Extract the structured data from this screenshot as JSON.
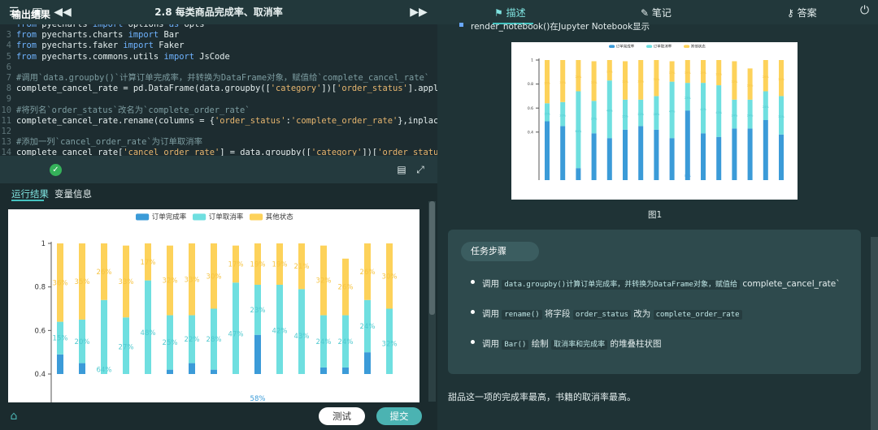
{
  "header": {
    "title": "2.8 每类商品完成率、取消率"
  },
  "code_lines": [
    {
      "n": "",
      "parts": [
        [
          "kw",
          "from"
        ],
        [
          "tx",
          " pyecharts "
        ],
        [
          "kw",
          "import"
        ],
        [
          "tx",
          " options "
        ],
        [
          "kw",
          "as"
        ],
        [
          "tx",
          " opts"
        ]
      ]
    },
    {
      "n": "3",
      "parts": [
        [
          "kw",
          "from"
        ],
        [
          "tx",
          " pyecharts.charts "
        ],
        [
          "kw",
          "import"
        ],
        [
          "tx",
          " Bar"
        ]
      ]
    },
    {
      "n": "4",
      "parts": [
        [
          "kw",
          "from"
        ],
        [
          "tx",
          " pyecharts.faker "
        ],
        [
          "kw",
          "import"
        ],
        [
          "tx",
          " Faker"
        ]
      ]
    },
    {
      "n": "5",
      "parts": [
        [
          "kw",
          "from"
        ],
        [
          "tx",
          " pyecharts.commons.utils "
        ],
        [
          "kw",
          "import"
        ],
        [
          "tx",
          " JsCode"
        ]
      ]
    },
    {
      "n": "6",
      "parts": []
    },
    {
      "n": "7",
      "parts": [
        [
          "cm",
          "#调用`data.groupby()`计算订单完成率，并转换为DataFrame对象，赋值给`complete_cancel_rate`"
        ]
      ]
    },
    {
      "n": "8",
      "parts": [
        [
          "tx",
          "complete_cancel_rate = pd.DataFrame(data.groupby(["
        ],
        [
          "st",
          "'category'"
        ],
        [
          "tx",
          "])["
        ],
        [
          "st",
          "'order_status'"
        ],
        [
          "tx",
          "].apply("
        ],
        [
          "kw",
          "lambda"
        ],
        [
          "tx",
          " x:1"
        ]
      ]
    },
    {
      "n": "9",
      "parts": []
    },
    {
      "n": "10",
      "parts": [
        [
          "cm",
          "#将列名`order_status`改名为`complete_order_rate`"
        ]
      ]
    },
    {
      "n": "11",
      "parts": [
        [
          "tx",
          "complete_cancel_rate.rename(columns = {"
        ],
        [
          "st",
          "'order_status'"
        ],
        [
          "tx",
          ":"
        ],
        [
          "st",
          "'complete_order_rate'"
        ],
        [
          "tx",
          "},inplace = "
        ],
        [
          "nb",
          "True"
        ],
        [
          "tx",
          ")"
        ]
      ]
    },
    {
      "n": "12",
      "parts": []
    },
    {
      "n": "13",
      "parts": [
        [
          "cm",
          "#添加一列`cancel_order_rate`为订单取消率"
        ]
      ]
    },
    {
      "n": "14",
      "parts": [
        [
          "tx",
          "complete_cancel_rate["
        ],
        [
          "st",
          "'cancel_order_rate'"
        ],
        [
          "tx",
          "] = data.groupby(["
        ],
        [
          "st",
          "'category'"
        ],
        [
          "tx",
          "])["
        ],
        [
          "st",
          "'order_status'"
        ],
        [
          "tx",
          "].apply(la"
        ]
      ]
    }
  ],
  "output": {
    "label": "输出结果",
    "tab_run": "运行结果",
    "tab_vars": "变量信息"
  },
  "buttons": {
    "test": "测试",
    "submit": "提交"
  },
  "right_tabs": {
    "describe": "描述",
    "notes": "笔记",
    "answer": "答案"
  },
  "right": {
    "render_text": "render_notebook()在Jupyter Notebook显示",
    "figure_caption": "图1",
    "task_header": "任务步骤",
    "steps": [
      {
        "pre": "调用 ",
        "code": "data.groupby()计算订单完成率，并转换为DataFrame对象，赋值给",
        "post": " complete_cancel_rate`"
      },
      {
        "pre": "调用 ",
        "code": "rename()",
        "mid": " 将字段 ",
        "code2": "order_status",
        "mid2": " 改为 ",
        "code3": "complete_order_rate"
      },
      {
        "pre": "调用 ",
        "code": "Bar()",
        "mid": " 绘制 ",
        "code2": "取消率和完成率",
        "mid2": " 的堆叠柱状图"
      }
    ],
    "conclusion": "甜品这一项的完成率最高，书籍的取消率最高。"
  },
  "chart_data": {
    "type": "bar",
    "stacked": true,
    "legend": [
      "订单完成率",
      "订单取消率",
      "其他状态"
    ],
    "colors": [
      "#3b9bd8",
      "#6fdfe0",
      "#fdd25a"
    ],
    "ylim": [
      0,
      1
    ],
    "yticks": [
      0.4,
      0.6,
      0.8,
      1
    ],
    "series": [
      {
        "name": "订单完成率",
        "values": [
          0.49,
          0.45,
          0.1,
          0.39,
          0.35,
          0.42,
          0.45,
          0.42,
          0.35,
          0.58,
          0.39,
          0.36,
          0.43,
          0.43,
          0.5,
          0.38
        ]
      },
      {
        "name": "订单取消率",
        "values": [
          0.15,
          0.2,
          0.64,
          0.27,
          0.48,
          0.25,
          0.22,
          0.28,
          0.47,
          0.23,
          0.42,
          0.43,
          0.24,
          0.24,
          0.24,
          0.32
        ]
      },
      {
        "name": "其他状态",
        "values": [
          0.36,
          0.35,
          0.26,
          0.33,
          0.17,
          0.32,
          0.33,
          0.3,
          0.17,
          0.19,
          0.19,
          0.21,
          0.32,
          0.26,
          0.26,
          0.3
        ]
      }
    ],
    "labels_completion": [
      "",
      "",
      "",
      "",
      "",
      "",
      "",
      "",
      "",
      "58%",
      "",
      "",
      "",
      "",
      "",
      ""
    ],
    "labels_cancel": [
      "15%",
      "20%",
      "64%",
      "27%",
      "48%",
      "25%",
      "22%",
      "28%",
      "47%",
      "23%",
      "42%",
      "43%",
      "24%",
      "24%",
      "24%",
      "32%"
    ],
    "labels_other": [
      "36%",
      "35%",
      "26%",
      "33%",
      "17%",
      "32%",
      "33%",
      "30%",
      "17%",
      "19%",
      "19%",
      "21%",
      "32%",
      "26%",
      "26%",
      "30%"
    ]
  }
}
